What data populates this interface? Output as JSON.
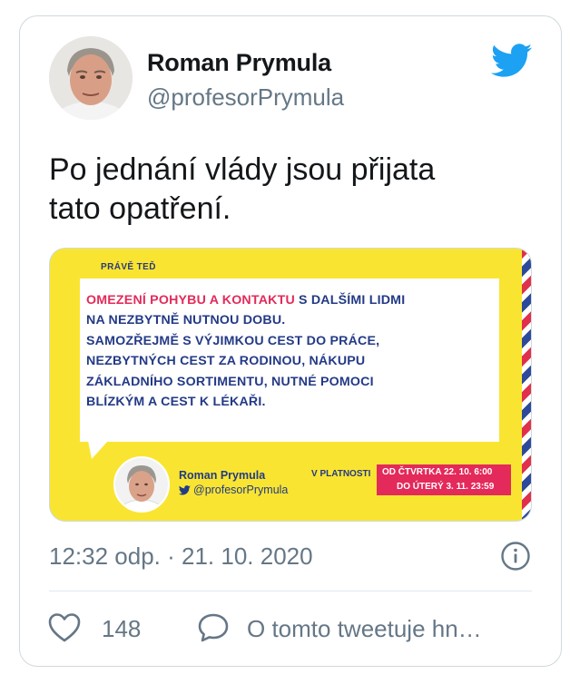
{
  "tweet": {
    "author_name": "Roman Prymula",
    "author_handle": "@profesorPrymula",
    "text_line1": "Po jednání vlády jsou přijata",
    "text_line2": "tato opatření.",
    "timestamp": "12:32 odp. · 21. 10. 2020",
    "like_count": "148",
    "discuss_label": "O tomto tweetuje hn…"
  },
  "media": {
    "header_label": "PRÁVĚ TEĎ",
    "highlight": "OMEZENÍ POHYBU A KONTAKTU",
    "line1_rest": " S DALŠÍMI LIDMI",
    "line2": "NA NEZBYTNĚ NUTNOU DOBU.",
    "line3": "SAMOZŘEJMĚ S VÝJIMKOU CEST DO PRÁCE,",
    "line4": "NEZBYTNÝCH CEST ZA RODINOU, NÁKUPU",
    "line5": "ZÁKLADNÍHO SORTIMENTU, NUTNÉ POMOCI",
    "line6": "BLÍZKÝM A CEST K LÉKAŘI.",
    "signature_name": "Roman Prymula",
    "signature_handle": "@profesorPrymula",
    "validity_label": "V PLATNOSTI",
    "date_from": "OD ČTVRTKA 22. 10. 6:00",
    "date_to": "DO ÚTERÝ 3. 11. 23:59"
  },
  "colors": {
    "twitter_blue": "#1da1f2",
    "banner_yellow": "#f9e531",
    "highlight_pink": "#e32a5a",
    "text_navy": "#233a86",
    "muted_gray": "#657786"
  },
  "icons": [
    "twitter-bird-icon",
    "info-icon",
    "heart-icon",
    "reply-bubble-icon"
  ]
}
